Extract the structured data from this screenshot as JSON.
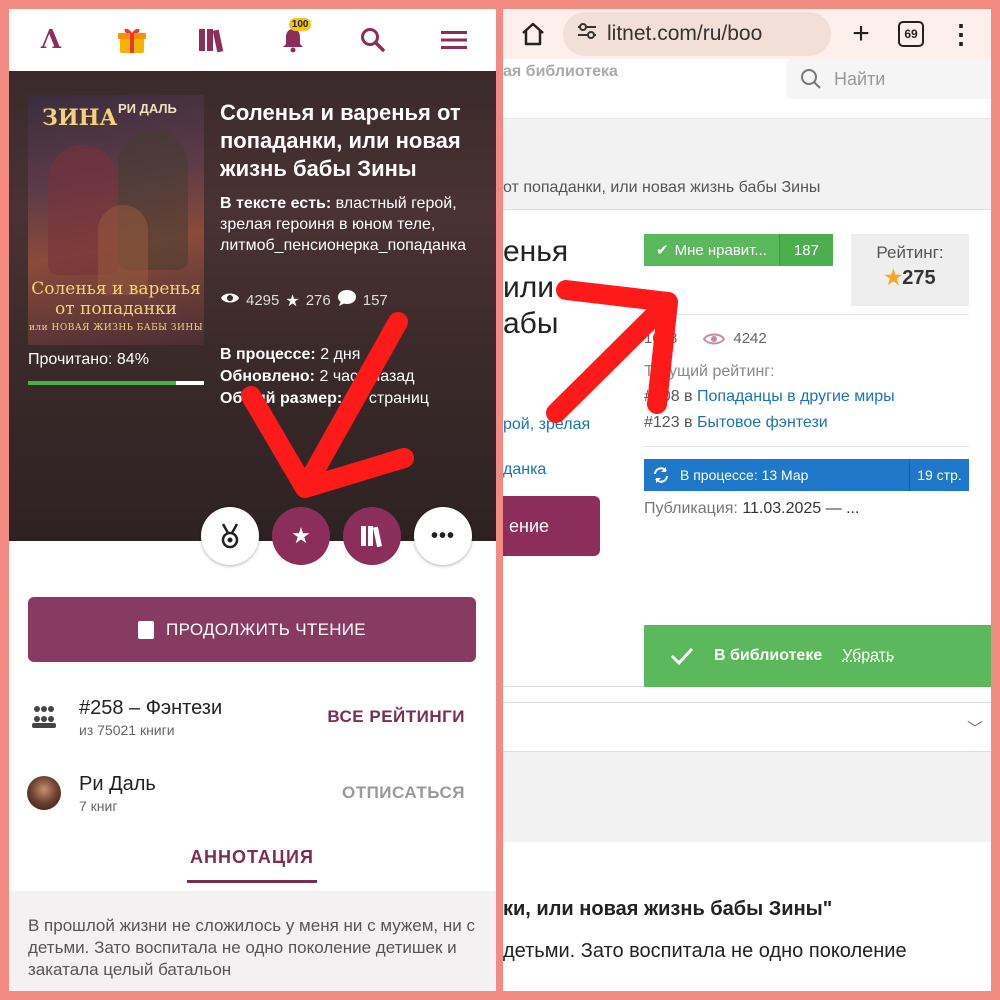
{
  "left": {
    "nav": {
      "logo": "Λ",
      "gift_icon": "gift-icon",
      "library_icon": "library-icon",
      "notifications_badge": "100",
      "search_icon": "search-icon",
      "menu_icon": "menu-icon"
    },
    "cover": {
      "author": "РИ ДАЛЬ",
      "top_text": "ЗИНА",
      "title_main": "Соленья и варенья от попаданки",
      "title_sub": "или НОВАЯ ЖИЗНЬ БАБЫ ЗИНЫ"
    },
    "progress": {
      "label": "Прочитано: 84%",
      "value": 0.84
    },
    "book_title": "Соленья и варенья от попаданки, или новая жизнь бабы Зины",
    "tags_label": "В тексте есть:",
    "tags_text": "властный герой, зрелая героиня в юном теле, литмоб_пенсионерка_попаданка",
    "stats": {
      "views": "4295",
      "stars": "276",
      "comments": "157"
    },
    "meta": {
      "status_label": "В процессе:",
      "status_value": "2 дня",
      "updated_label": "Обновлено:",
      "updated_value": "2 часа назад",
      "size_label": "Общий размер:",
      "size_value": "19 страниц"
    },
    "actions": [
      "medal-icon",
      "star-icon",
      "library-icon",
      "more-icon"
    ],
    "continue_label": "ПРОДОЛЖИТЬ ЧТЕНИЕ",
    "rank": {
      "title": "#258 – Фэнтези",
      "sub": "из 75021 книги",
      "action": "ВСЕ РЕЙТИНГИ"
    },
    "author": {
      "name": "Ри Даль",
      "sub": "7 книг",
      "action": "ОТПИСАТЬСЯ"
    },
    "annotation_tab": "АННОТАЦИЯ",
    "annotation_text": "В прошлой жизни не сложилось у меня ни с мужем, ни с детьми. Зато воспитала не одно поколение детишек и закатала целый батальон"
  },
  "right": {
    "browser": {
      "url": "litnet.com/ru/boo",
      "tabs_count": "69"
    },
    "header": {
      "library_text": "ая библиотека",
      "search_placeholder": "Найти"
    },
    "breadcrumb": "от попаданки, или новая жизнь бабы Зины",
    "title_fragment": "енья\nили\nабы",
    "like": {
      "label": "Мне нравит...",
      "count": "187"
    },
    "rating": {
      "label": "Рейтинг:",
      "value": "275"
    },
    "counts": {
      "first": "1068",
      "views": "4242"
    },
    "current_rating_label": "Текущий рейтинг:",
    "rank1": {
      "prefix": "#108 в",
      "link": "Попаданцы в другие миры"
    },
    "rank2": {
      "prefix": "#123 в",
      "link": "Бытовое фэнтези"
    },
    "tags": {
      "line1_a": "рой,",
      "line1_b": "зрелая",
      "line2": "данка"
    },
    "status": {
      "text": "В процессе: 13 Мар",
      "pages": "19 стр."
    },
    "publication": {
      "label": "Публикация:",
      "value": "11.03.2025 — ..."
    },
    "read_button": "ение",
    "library": {
      "label": "В библиотеке",
      "remove": "Убрать"
    },
    "annotation_title": "ки, или новая жизнь бабы Зины\"",
    "annotation_text": "детьми. Зато воспитала не одно поколение"
  },
  "colors": {
    "brand": "#8b2e5c",
    "green": "#5cb85c",
    "blue": "#1f77c9",
    "border": "#f28b82",
    "arrow": "#ff1a1a"
  }
}
